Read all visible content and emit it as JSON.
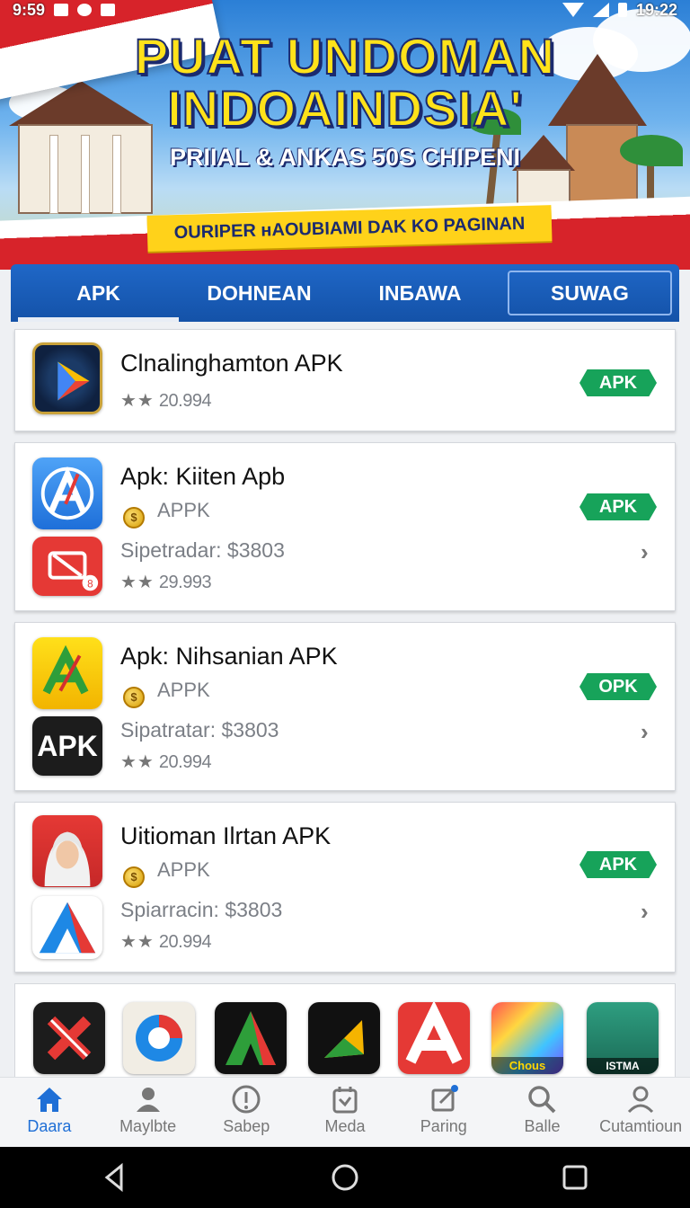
{
  "status_bar": {
    "time_left": "9:59",
    "time_right": "19:22"
  },
  "banner": {
    "headline_line1": "PUAT UNDOMAN",
    "headline_line2": "INDOAINDSIA'",
    "subline": "PRIIAL & ANKAS 50S CHIPENI",
    "ribbon": "OURIPER ʜAOUBIAMI DAK KO PAGINAN"
  },
  "tabs": [
    {
      "label": "APK"
    },
    {
      "label": "DOHNEAN"
    },
    {
      "label": "INБAWA"
    },
    {
      "label": "SUWAG"
    }
  ],
  "cards": [
    {
      "title": "Clnalinghamton APK",
      "rating": "20.994",
      "badge": "APK"
    },
    {
      "title": "Apk: Kiiten Apb",
      "developer": "APPK",
      "price": "Sipetradar: $3803",
      "rating": "29.993",
      "badge": "APK",
      "second_icon_badge": "8"
    },
    {
      "title": "Apk: Nihsanian APK",
      "developer": "APPK",
      "price": "Sipatratar: $3803",
      "rating": "20.994",
      "badge": "OPK",
      "second_icon_text": "APK"
    },
    {
      "title": "Uitioman Ilrtan APK",
      "developer": "APPK",
      "price": "Spiarracin: $3803",
      "rating": "20.994",
      "badge": "APK"
    }
  ],
  "strip_icons": [
    {
      "name": "red-x-app-icon",
      "label": ""
    },
    {
      "name": "browser-app-icon",
      "label": ""
    },
    {
      "name": "green-a-app-icon",
      "label": ""
    },
    {
      "name": "play-triangle-app-icon",
      "label": ""
    },
    {
      "name": "red-a-app-icon",
      "label": ""
    },
    {
      "name": "avatar-app-icon",
      "label": "Chous"
    },
    {
      "name": "person-app-icon",
      "label": "ISTMA"
    }
  ],
  "bottom_nav": [
    {
      "label": "Daara",
      "icon": "home-icon",
      "active": true
    },
    {
      "label": "Maylbte",
      "icon": "user-icon"
    },
    {
      "label": "Sabep",
      "icon": "info-icon"
    },
    {
      "label": "Meda",
      "icon": "calendar-icon"
    },
    {
      "label": "Paring",
      "icon": "edit-icon"
    },
    {
      "label": "Balle",
      "icon": "search-icon"
    },
    {
      "label": "Cutamtioun",
      "icon": "person-icon"
    }
  ],
  "colors": {
    "accent": "#1f6fd6",
    "badge_green": "#17a35a",
    "tab_blue": "#1a5db8",
    "flag_red": "#d7232a"
  }
}
